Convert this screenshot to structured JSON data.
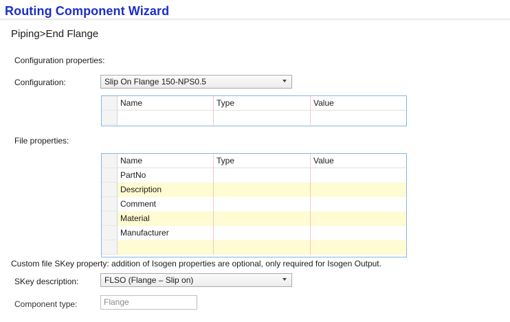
{
  "header": {
    "title": "Routing Component Wizard",
    "breadcrumb": "Piping>End Flange"
  },
  "configuration": {
    "section_label": "Configuration properties:",
    "label": "Configuration:",
    "selected": "Slip On Flange 150-NPS0.5",
    "grid_columns": [
      "Name",
      "Type",
      "Value"
    ],
    "rows": [
      {
        "name": "",
        "type": "",
        "value": ""
      }
    ]
  },
  "file_properties": {
    "section_label": "File properties:",
    "grid_columns": [
      "Name",
      "Type",
      "Value"
    ],
    "rows": [
      {
        "name": "PartNo",
        "type": "",
        "value": ""
      },
      {
        "name": "Description",
        "type": "",
        "value": ""
      },
      {
        "name": "Comment",
        "type": "",
        "value": ""
      },
      {
        "name": "Material",
        "type": "",
        "value": ""
      },
      {
        "name": "Manufacturer",
        "type": "",
        "value": ""
      },
      {
        "name": "",
        "type": "",
        "value": ""
      }
    ]
  },
  "skey": {
    "note": "Custom file SKey property:  addition of Isogen properties are optional, only required for Isogen Output.",
    "label": "SKey description:",
    "selected": "FLSO  (Flange – Slip on)"
  },
  "component_type": {
    "label": "Component type:",
    "value": "Flange"
  },
  "colors": {
    "title": "#1a2ec8",
    "grid_border": "#86b6e0",
    "highlight_row": "#fffbd2"
  }
}
